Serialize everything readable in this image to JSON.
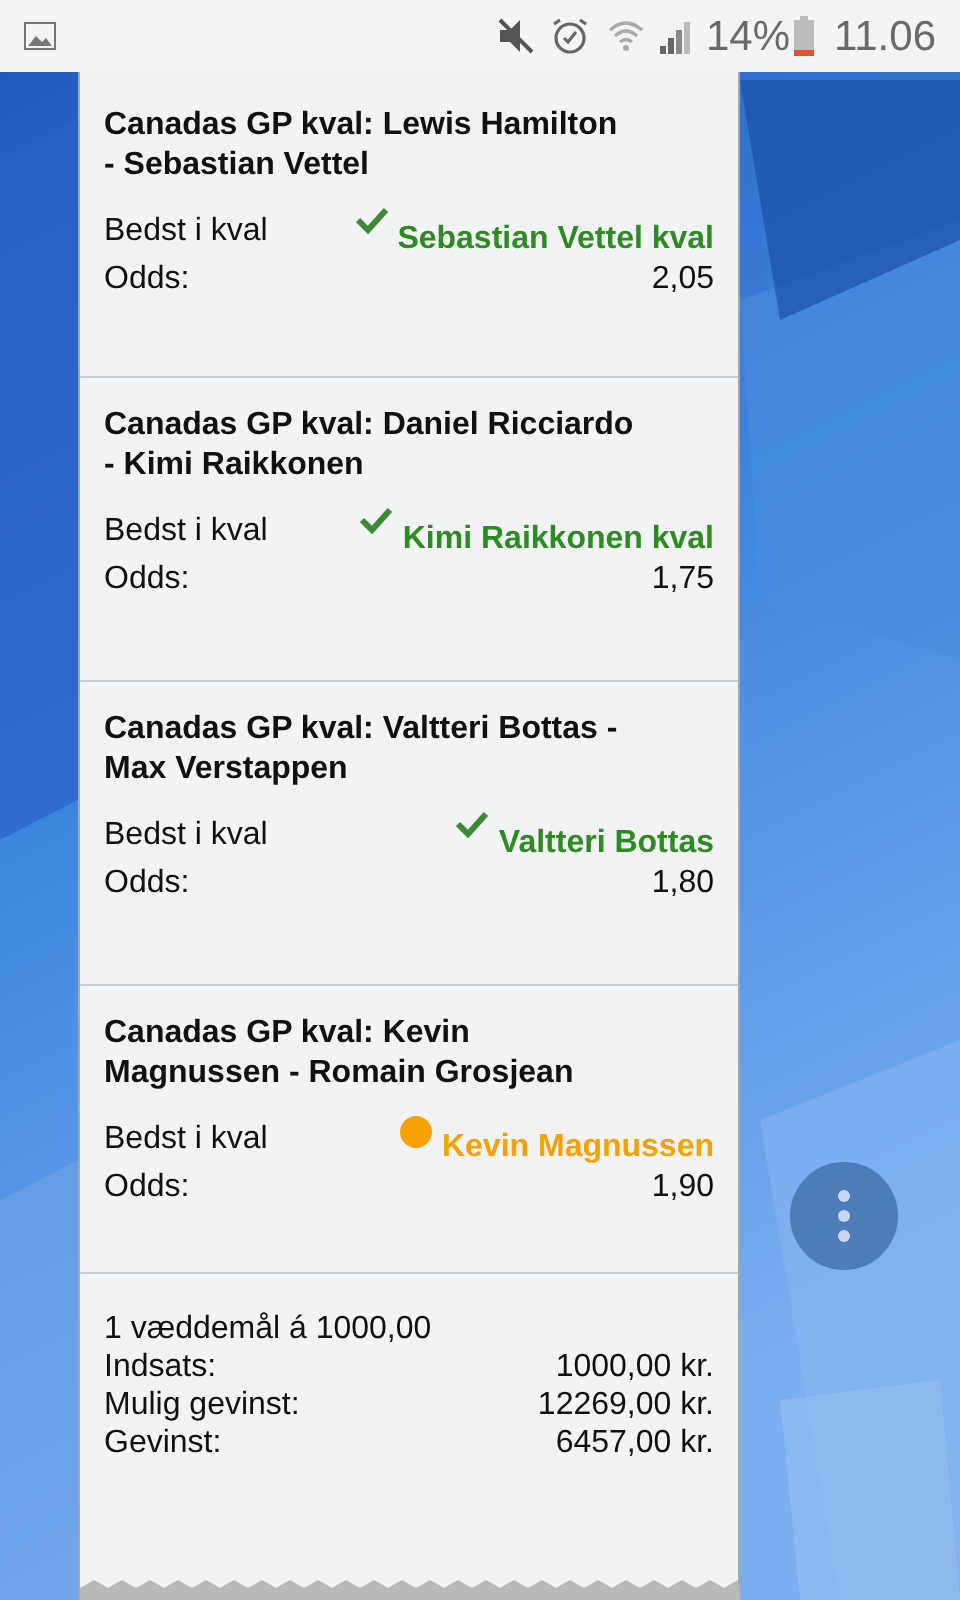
{
  "status_bar": {
    "battery_percent": "14%",
    "time": "11.06"
  },
  "bets": [
    {
      "title": "Canadas GP kval: Lewis Hamilton - Sebastian Vettel",
      "market": "Bedst i kval",
      "pick": "Sebastian Vettel kval",
      "kind": "won",
      "odds_label": "Odds:",
      "odds": "2,05"
    },
    {
      "title": "Canadas GP kval: Daniel Ricciardo - Kimi Raikkonen",
      "market": "Bedst i kval",
      "pick": "Kimi Raikkonen kval",
      "kind": "won",
      "odds_label": "Odds:",
      "odds": "1,75"
    },
    {
      "title": "Canadas GP kval: Valtteri Bottas - Max Verstappen",
      "market": "Bedst i kval",
      "pick": "Valtteri Bottas",
      "kind": "won",
      "odds_label": "Odds:",
      "odds": "1,80"
    },
    {
      "title": "Canadas GP kval: Kevin Magnussen - Romain Grosjean",
      "market": "Bedst i kval",
      "pick": "Kevin Magnussen",
      "kind": "pending",
      "odds_label": "Odds:",
      "odds": "1,90"
    }
  ],
  "summary": {
    "heading": "1 væddemål á 1000,00",
    "rows": [
      {
        "label": "Indsats:",
        "value": "1000,00 kr."
      },
      {
        "label": "Mulig gevinst:",
        "value": "12269,00 kr."
      },
      {
        "label": "Gevinst:",
        "value": "6457,00 kr."
      }
    ]
  }
}
